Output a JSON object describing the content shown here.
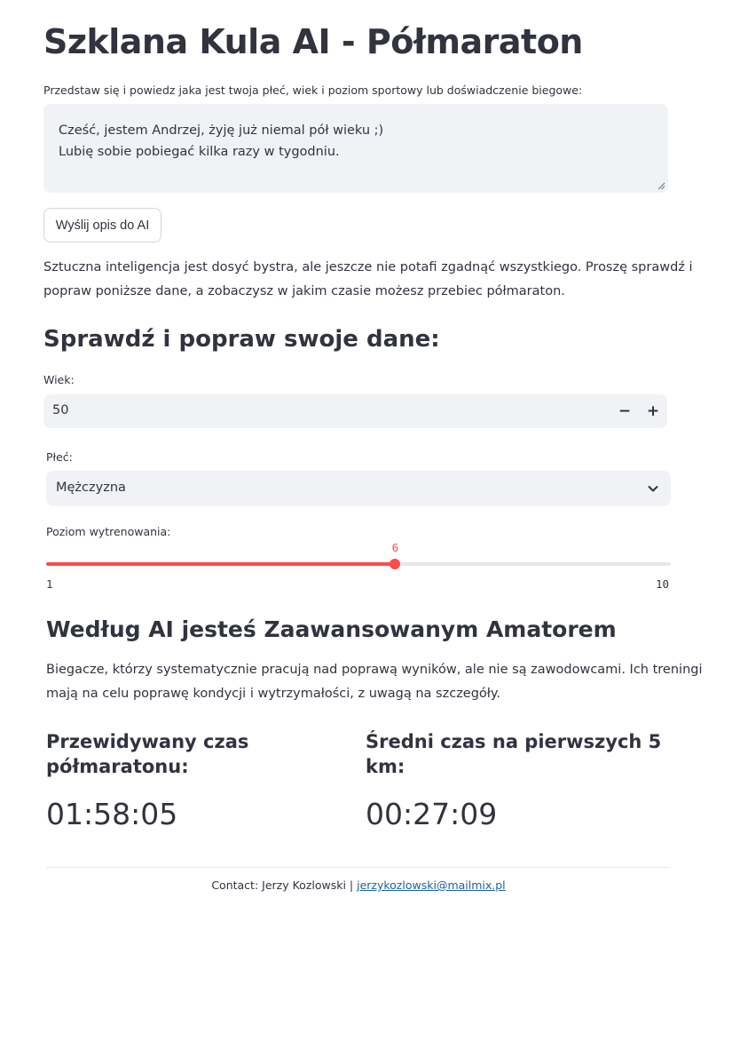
{
  "page": {
    "title": "Szklana Kula AI - Półmaraton"
  },
  "description_form": {
    "label": "Przedstaw się i powiedz jaka jest twoja płeć, wiek i poziom sportowy lub doświadczenie biegowe:",
    "textarea_lines": [
      "Cześć, jestem Andrzej, żyję już niemal pół wieku ;)",
      "Lubię sobie pobiegać kilka razy w tygodniu."
    ],
    "submit_label": "Wyślij opis do AI"
  },
  "info": {
    "line1": "Sztuczna inteligencja jest dosyć bystra, ale jeszcze nie potafi zgadnąć wszystkiego. Proszę sprawdź i",
    "line2": "popraw poniższe dane, a zobaczysz w jakim czasie możesz przebiec półmaraton."
  },
  "verify": {
    "heading": "Sprawdź i popraw swoje dane:",
    "age": {
      "label": "Wiek:",
      "value": "50",
      "minus": "−",
      "plus": "+"
    },
    "gender": {
      "label": "Płeć:",
      "selected": "Mężczyzna"
    },
    "training": {
      "label": "Poziom wytrenowania:",
      "value": 6,
      "value_text": "6",
      "min": 1,
      "max": 10,
      "min_text": "1",
      "max_text": "10"
    }
  },
  "result": {
    "heading": "Według AI jesteś Zaawansowanym Amatorem",
    "desc_line1": "Biegacze, którzy systematycznie pracują nad poprawą wyników, ale nie są zawodowcami. Ich treningi",
    "desc_line2": "mają na celu poprawę kondycji i wytrzymałości, z uwagą na szczegóły.",
    "metric1": {
      "label_line1": "Przewidywany czas",
      "label_line2": "półmaratonu:",
      "value": "01:58:05"
    },
    "metric2": {
      "label_line1": "Średni czas na pierwszych 5",
      "label_line2": "km:",
      "value": "00:27:09"
    }
  },
  "footer": {
    "prefix": "Contact: Jerzy Kozlowski | ",
    "email": "jerzykozlowski@mailmix.pl"
  },
  "colors": {
    "accent": "#ff4b4b",
    "input_bg": "#f0f2f6",
    "text": "#31333f",
    "link": "#1a62a6"
  }
}
